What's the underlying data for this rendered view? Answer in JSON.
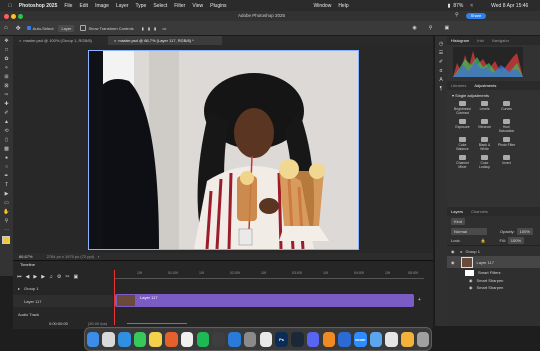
{
  "menubar": {
    "app": "Photoshop 2025",
    "items": [
      "File",
      "Edit",
      "Image",
      "Layer",
      "Type",
      "Select",
      "Filter",
      "View",
      "Plugins",
      "Window",
      "Help"
    ],
    "battery": "87%",
    "clock": "Wed 8 Apr 15:46"
  },
  "titlebar": {
    "title": "Adobe Photoshop 2025",
    "share": "Share"
  },
  "options": {
    "auto_select": "Auto-Select:",
    "layer_value": "Layer",
    "transform": "Show Transform Controls",
    "more": "•••"
  },
  "tabs": [
    {
      "label": "master.psd @ 100% (Group 1, RGB/8)"
    },
    {
      "label": "master.psd @ 66.7% (Layer 117, RGB/8) *"
    }
  ],
  "status": {
    "zoom": "66.67%",
    "info": "2784 px x 1970 px (72 ppi)"
  },
  "timeline": {
    "title": "Timeline",
    "ruler": [
      "10f",
      "01:00f",
      "10f",
      "02:00f",
      "10f",
      "03:00f",
      "10f",
      "04:00f",
      "10f",
      "05:00f"
    ],
    "group": "Group 1",
    "layer": "Layer 117",
    "clip": "Layer 117",
    "audio": "Audio Track",
    "timecode": "0:00:00:00",
    "fps": "(30.00 fps)"
  },
  "histogram": {
    "tabs": [
      "Histogram",
      "Info",
      "Navigator"
    ]
  },
  "adjustments": {
    "tabs": [
      "Libraries",
      "Adjustments"
    ],
    "section": "Single adjustments",
    "items": [
      "Brightness/ Contrast",
      "Levels",
      "Curves",
      "Exposure",
      "Vibrance",
      "Hue/ Saturation",
      "Color Balance",
      "Black & White",
      "Photo Filter",
      "Channel Mixer",
      "Color Lookup",
      "Invert"
    ]
  },
  "layers": {
    "tabs": [
      "Layers",
      "Channels"
    ],
    "kind": "Kind",
    "blend": "Normal",
    "opacity_label": "Opacity:",
    "opacity": "100%",
    "lock_label": "Lock:",
    "fill_label": "Fill:",
    "fill": "100%",
    "rows": [
      {
        "name": "Group 1"
      },
      {
        "name": "Layer 117"
      },
      {
        "name": "Smart Filters"
      },
      {
        "name": "Smart Sharpen"
      },
      {
        "name": "Smart Sharpen"
      }
    ]
  },
  "dock": {
    "apps": [
      {
        "name": "finder",
        "color": "#3b8de8"
      },
      {
        "name": "launchpad",
        "color": "#d9d9d9"
      },
      {
        "name": "safari",
        "color": "#2f8fe0"
      },
      {
        "name": "messages",
        "color": "#38c95a"
      },
      {
        "name": "notes",
        "color": "#f5d04a"
      },
      {
        "name": "firefox",
        "color": "#e5602b"
      },
      {
        "name": "photos",
        "color": "#f0f0f0"
      },
      {
        "name": "spotify",
        "color": "#1db954"
      },
      {
        "name": "bridge",
        "color": "#3e3e3e"
      },
      {
        "name": "davinci",
        "color": "#2a7ad9"
      },
      {
        "name": "system-settings",
        "color": "#8a8a8a"
      },
      {
        "name": "chrome",
        "color": "#e9e9e9"
      },
      {
        "name": "photoshop",
        "color": "#0b2c57",
        "text": "Ps"
      },
      {
        "name": "steam",
        "color": "#1b2838"
      },
      {
        "name": "discord",
        "color": "#5865f2"
      },
      {
        "name": "vlc",
        "color": "#f08a24"
      },
      {
        "name": "word",
        "color": "#2c6bd4"
      },
      {
        "name": "zoom",
        "color": "#2d8cff",
        "text": "zoom"
      },
      {
        "name": "mail",
        "color": "#5aa7f0"
      },
      {
        "name": "finder-2",
        "color": "#e5e5e5"
      },
      {
        "name": "pencil",
        "color": "#f2b338"
      },
      {
        "name": "trash",
        "color": "#a0a0a0"
      }
    ]
  },
  "colors": {
    "accent": "#2f80ed",
    "clip": "#7b5bc4",
    "selection": "#8ab4ff"
  }
}
